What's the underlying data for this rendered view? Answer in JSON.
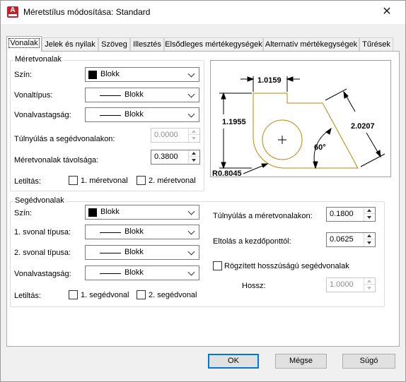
{
  "window": {
    "title": "Méretstílus módosítása: Standard",
    "app_icon_letter": "A",
    "close_glyph": "✕"
  },
  "tabs": [
    {
      "label": "Vonalak",
      "active": true
    },
    {
      "label": "Jelek és nyilak",
      "active": false
    },
    {
      "label": "Szöveg",
      "active": false
    },
    {
      "label": "Illesztés",
      "active": false
    },
    {
      "label": "Elsődleges mértékegységek",
      "active": false
    },
    {
      "label": "Alternatív mértékegységek",
      "active": false
    },
    {
      "label": "Tűrések",
      "active": false
    }
  ],
  "dim_lines": {
    "group_title": "Méretvonalak",
    "color_label": "Szín:",
    "color_value": "Blokk",
    "linetype_label": "Vonaltípus:",
    "linetype_value": "Blokk",
    "lineweight_label": "Vonalvastagság:",
    "lineweight_value": "Blokk",
    "extend_label": "Túlnyúlás a segédvonalakon:",
    "extend_value": "0.0000",
    "baseline_label": "Méretvonalak távolsága:",
    "baseline_value": "0.3800",
    "suppress_label": "Letiltás:",
    "suppress_1": "1. méretvonal",
    "suppress_2": "2. méretvonal"
  },
  "ext_lines": {
    "group_title": "Segédvonalak",
    "color_label": "Szín:",
    "color_value": "Blokk",
    "lt1_label": "1. svonal típusa:",
    "lt1_value": "Blokk",
    "lt2_label": "2. svonal típusa:",
    "lt2_value": "Blokk",
    "lineweight_label": "Vonalvastagság:",
    "lineweight_value": "Blokk",
    "suppress_label": "Letiltás:",
    "suppress_1": "1. segédvonal",
    "suppress_2": "2. segédvonal",
    "extend_label": "Túlnyúlás a méretvonalakon:",
    "extend_value": "0.1800",
    "offset_label": "Eltolás a kezdőponttól:",
    "offset_value": "0.0625",
    "fixed_label": "Rögzített hosszúságú segédvonalak",
    "length_label": "Hossz:",
    "length_value": "1.0000"
  },
  "preview": {
    "dim_top": "1.0159",
    "dim_left": "1.1955",
    "dim_right": "2.0207",
    "dim_angle": "60°",
    "dim_radius": "R0.8045"
  },
  "buttons": {
    "ok": "OK",
    "cancel": "Mégse",
    "help": "Súgó"
  },
  "colors": {
    "accent": "#0078d7",
    "preview_geometry": "#b8860b",
    "app_icon": "#c8202a"
  }
}
